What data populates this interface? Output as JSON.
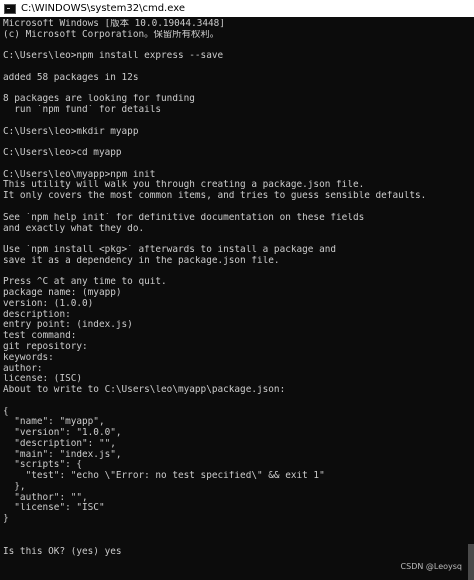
{
  "window": {
    "title": "C:\\WINDOWS\\system32\\cmd.exe",
    "title_icon": "console-icon"
  },
  "console": {
    "lines": [
      "Microsoft Windows [版本 10.0.19044.3448]",
      "(c) Microsoft Corporation。保留所有权利。",
      "",
      "C:\\Users\\leo>npm install express --save",
      "",
      "added 58 packages in 12s",
      "",
      "8 packages are looking for funding",
      "  run `npm fund` for details",
      "",
      "C:\\Users\\leo>mkdir myapp",
      "",
      "C:\\Users\\leo>cd myapp",
      "",
      "C:\\Users\\leo\\myapp>npm init",
      "This utility will walk you through creating a package.json file.",
      "It only covers the most common items, and tries to guess sensible defaults.",
      "",
      "See `npm help init` for definitive documentation on these fields",
      "and exactly what they do.",
      "",
      "Use `npm install <pkg>` afterwards to install a package and",
      "save it as a dependency in the package.json file.",
      "",
      "Press ^C at any time to quit.",
      "package name: (myapp)",
      "version: (1.0.0)",
      "description:",
      "entry point: (index.js)",
      "test command:",
      "git repository:",
      "keywords:",
      "author:",
      "license: (ISC)",
      "About to write to C:\\Users\\leo\\myapp\\package.json:",
      "",
      "{",
      "  \"name\": \"myapp\",",
      "  \"version\": \"1.0.0\",",
      "  \"description\": \"\",",
      "  \"main\": \"index.js\",",
      "  \"scripts\": {",
      "    \"test\": \"echo \\\"Error: no test specified\\\" && exit 1\"",
      "  },",
      "  \"author\": \"\",",
      "  \"license\": \"ISC\"",
      "}",
      "",
      "",
      "Is this OK? (yes) yes"
    ]
  },
  "watermark": "CSDN @Leoysq"
}
